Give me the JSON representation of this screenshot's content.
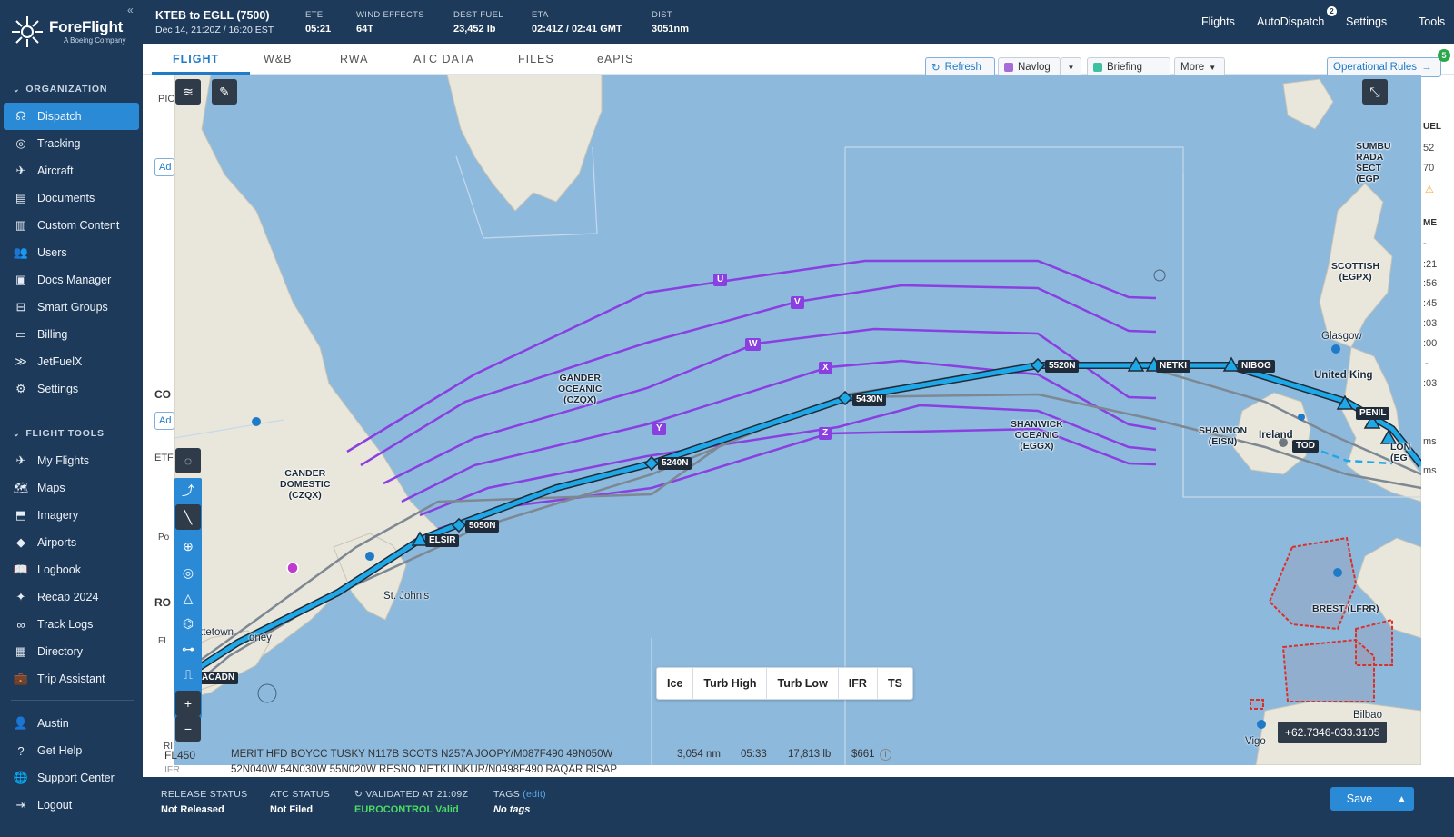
{
  "brand": {
    "name": "ForeFlight",
    "sub": "A Boeing Company"
  },
  "sidebar": {
    "collapse_icon": "«",
    "org_heading": "ORGANIZATION",
    "org_items": [
      {
        "label": "Dispatch",
        "icon": "headset-icon",
        "active": true
      },
      {
        "label": "Tracking",
        "icon": "radar-icon"
      },
      {
        "label": "Aircraft",
        "icon": "airplane-icon"
      },
      {
        "label": "Documents",
        "icon": "documents-icon"
      },
      {
        "label": "Custom Content",
        "icon": "custom-content-icon"
      },
      {
        "label": "Users",
        "icon": "users-icon"
      },
      {
        "label": "Docs Manager",
        "icon": "docs-manager-icon"
      },
      {
        "label": "Smart Groups",
        "icon": "smart-groups-icon"
      },
      {
        "label": "Billing",
        "icon": "billing-icon"
      },
      {
        "label": "JetFuelX",
        "icon": "jetfuelx-icon"
      },
      {
        "label": "Settings",
        "icon": "gear-icon"
      }
    ],
    "tools_heading": "FLIGHT TOOLS",
    "tool_items": [
      {
        "label": "My Flights",
        "icon": "my-flights-icon"
      },
      {
        "label": "Maps",
        "icon": "maps-icon"
      },
      {
        "label": "Imagery",
        "icon": "imagery-icon"
      },
      {
        "label": "Airports",
        "icon": "airports-icon"
      },
      {
        "label": "Logbook",
        "icon": "logbook-icon"
      },
      {
        "label": "Recap 2024",
        "icon": "recap-icon"
      },
      {
        "label": "Track Logs",
        "icon": "track-logs-icon"
      },
      {
        "label": "Directory",
        "icon": "directory-icon"
      },
      {
        "label": "Trip Assistant",
        "icon": "trip-assistant-icon"
      }
    ],
    "bottom_items": [
      {
        "label": "Austin",
        "icon": "user-icon"
      },
      {
        "label": "Get Help",
        "icon": "help-icon"
      },
      {
        "label": "Support Center",
        "icon": "globe-icon"
      },
      {
        "label": "Logout",
        "icon": "logout-icon"
      }
    ]
  },
  "header": {
    "title": "KTEB to EGLL (7500)",
    "date": "Dec 14, 21:20Z / 16:20 EST",
    "stats": [
      {
        "label": "ETE",
        "value": "05:21"
      },
      {
        "label": "WIND EFFECTS",
        "value": "64T"
      },
      {
        "label": "DEST FUEL",
        "value": "23,452 lb"
      },
      {
        "label": "ETA",
        "value": "02:41Z / 02:41 GMT"
      },
      {
        "label": "DIST",
        "value": "3051nm"
      }
    ],
    "nav": [
      "Flights",
      "AutoDispatch",
      "Settings",
      "Tools"
    ],
    "autodispatch_badge": "2"
  },
  "tabs": {
    "items": [
      "FLIGHT",
      "W&B",
      "RWA",
      "ATC DATA",
      "FILES",
      "eAPIS"
    ],
    "active": "FLIGHT",
    "refresh": "Refresh",
    "navlog": "Navlog",
    "briefing": "Briefing",
    "more": "More",
    "operational_rules": "Operational Rules",
    "rules_badge": "5"
  },
  "background_peek": {
    "pic": "PIC",
    "co": "CO",
    "etf": "ETF",
    "po": "Po",
    "ro": "RO",
    "fl": "FL",
    "ri": "RI",
    "uel": "UEL",
    "me": "ME",
    "right_values": [
      "52",
      "70",
      "",
      "",
      ":21",
      ":56",
      ":45",
      ":03",
      ":00",
      "-",
      ":03"
    ],
    "ms1": "ms",
    "ms2": "ms"
  },
  "map": {
    "fir_labels": [
      "GANDER\nOCEANIC\n(CZQX)",
      "CANDER\nDOMESTIC\n(CZQX)",
      "SHANWICK\nOCEANIC\n(EGGX)",
      "SCOTTISH\n(EGPX)",
      "SUMBU\nRADA\nSECT\n(EGP",
      "SHANNON\n(EISN)",
      "LON\n(EG",
      "BREST (LFRR)"
    ],
    "cities": [
      "St. John's",
      "Glasgow",
      "United King",
      "Ireland",
      "Bilbao",
      "Vigo",
      "ttetown",
      "dney"
    ],
    "waypoints": [
      "5520N",
      "NETKI",
      "NIBOG",
      "5430N",
      "5240N",
      "5050N",
      "ELSIR",
      "ACADN",
      "PENIL",
      "TOD"
    ],
    "tracks": [
      "U",
      "V",
      "W",
      "X",
      "Y",
      "Z"
    ],
    "layers": [
      "Ice",
      "Turb High",
      "Turb Low",
      "IFR",
      "TS"
    ],
    "coordinates": "+62.7346-033.3105"
  },
  "route": {
    "level": "FL450",
    "rules": "IFR",
    "line1": "MERIT HFD BOYCC TUSKY N117B SCOTS N257A JOOPY/M087F490 49N050W",
    "line2": "52N040W 54N030W 55N020W RESNO NETKI INKUR/N0498F490 RAQAR RISAP",
    "distance": "3,054 nm",
    "time": "05:33",
    "fuel": "17,813 lb",
    "cost": "$661"
  },
  "footer": {
    "release_label": "RELEASE STATUS",
    "release_value": "Not Released",
    "atc_label": "ATC STATUS",
    "atc_value": "Not Filed",
    "validated_label": "VALIDATED AT 21:09Z",
    "validated_value": "EUROCONTROL Valid",
    "tags_label": "TAGS",
    "tags_edit": "(edit)",
    "tags_value": "No tags",
    "save": "Save"
  },
  "colors": {
    "nav_bg": "#1e3a5a",
    "active": "#2a8ad6",
    "route": "#1fa8e8",
    "track": "#8a3fe0",
    "ocean": "#8db9dd",
    "land": "#e9e6dc",
    "validated": "#4cd964"
  }
}
